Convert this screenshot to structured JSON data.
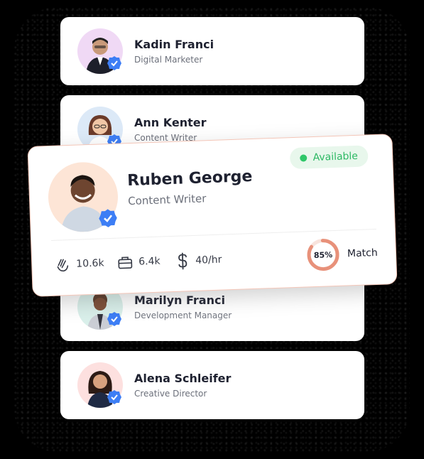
{
  "cards": [
    {
      "name": "Kadin Franci",
      "role": "Digital Marketer"
    },
    {
      "name": "Ann Kenter",
      "role": "Content Writer"
    },
    {
      "name": "Marilyn Franci",
      "role": "Development Manager"
    },
    {
      "name": "Alena Schleifer",
      "role": "Creative Director"
    }
  ],
  "featured": {
    "name": "Ruben George",
    "role": "Content Writer",
    "status": "Available",
    "stats": {
      "claps": "10.6k",
      "projects": "6.4k",
      "rate": "40/hr"
    },
    "match_percent": "85%",
    "match_value": 0.85,
    "match_label": "Match"
  },
  "colors": {
    "available_bg": "#e8f7ec",
    "available_text": "#2db964",
    "badge_blue": "#3d7ef5",
    "ring": "#e8917a",
    "ring_track": "#f8e3dc"
  },
  "icons": [
    "verified-badge-icon",
    "clap-icon",
    "briefcase-icon",
    "dollar-icon"
  ]
}
